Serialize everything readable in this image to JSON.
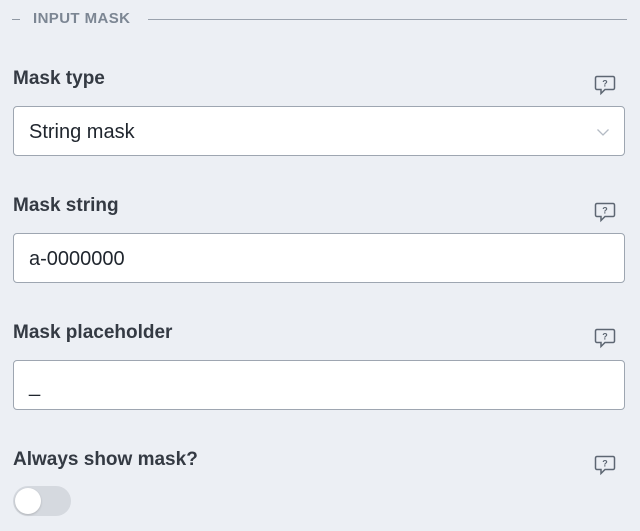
{
  "section": {
    "title": "INPUT MASK"
  },
  "fields": {
    "mask_type": {
      "label": "Mask type",
      "value": "String mask"
    },
    "mask_string": {
      "label": "Mask string",
      "value": "a-0000000"
    },
    "mask_placeholder": {
      "label": "Mask placeholder",
      "value": "_"
    },
    "always_show_mask": {
      "label": "Always show mask?",
      "enabled": false
    }
  },
  "icons": {
    "help": "help-chat-icon",
    "dropdown": "chevron-down-icon"
  },
  "colors": {
    "background": "#eceff4",
    "border": "#9ea6b1",
    "toggle_off": "#d5d9df"
  }
}
